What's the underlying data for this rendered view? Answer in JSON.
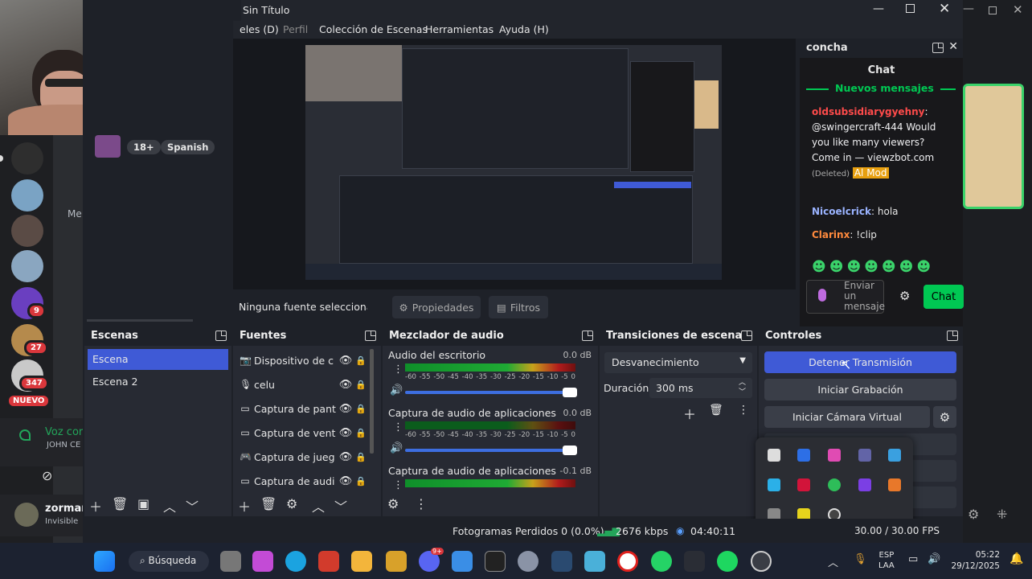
{
  "window": {
    "title": "Sin Título"
  },
  "menu": [
    "eles (D)",
    "Perfil",
    "Colección de Escenas",
    "Herramientas",
    "Ayuda (H)"
  ],
  "discord": {
    "tags": [
      "18+",
      "Spanish"
    ],
    "badges": [
      "9",
      "27",
      "347"
    ],
    "new_badge": "NUEVO",
    "voice": {
      "title": "Voz cor",
      "subtitle": "JOHN CE"
    },
    "user": {
      "name": "zorman",
      "status": "Invisible"
    },
    "partial_label": "Me"
  },
  "source_bar": {
    "status": "Ninguna fuente seleccionad",
    "properties": "Propiedades",
    "filters": "Filtros"
  },
  "scenes": {
    "title": "Escenas",
    "items": [
      "Escena",
      "Escena 2"
    ]
  },
  "sources": {
    "title": "Fuentes",
    "items": [
      "Dispositivo de c",
      "celu",
      "Captura de pant",
      "Captura de vent",
      "Captura de jueg",
      "Captura de audi"
    ]
  },
  "mixer": {
    "title": "Mezclador de audio",
    "channels": [
      {
        "name": "Audio del escritorio",
        "db": "0.0 dB"
      },
      {
        "name": "Captura de audio de aplicaciones (BE",
        "db": "0.0 dB"
      },
      {
        "name": "Captura de audio de aplicaciones (BE",
        "db": "-0.1 dB"
      }
    ],
    "scale": [
      "-60",
      "-55",
      "-50",
      "-45",
      "-40",
      "-35",
      "-30",
      "-25",
      "-20",
      "-15",
      "-10",
      "-5",
      "0"
    ]
  },
  "transitions": {
    "title": "Transiciones de escena",
    "selected": "Desvanecimiento",
    "duration_label": "Duración",
    "duration": "300 ms"
  },
  "controls": {
    "title": "Controles",
    "stop_stream": "Detener Transmisión",
    "start_recording": "Iniciar Grabación",
    "start_vcam": "Iniciar Cámara Virtual"
  },
  "chat": {
    "channel": "concha",
    "header": "Chat",
    "new_messages": "Nuevos mensajes",
    "messages": [
      {
        "user": "oldsubsidiarygyehny",
        "text": "@swingercraft-444 Would you like many viewers? Come in — viewzbot.com",
        "deleted": "(Deleted)",
        "tag": "Al Mod",
        "color": "#ff4b4b"
      },
      {
        "user": "Nicoelcrick",
        "text": "hola",
        "color": "#9ab3ff"
      },
      {
        "user": "Clarinx",
        "text": "!clip",
        "color": "#ff8a3d"
      }
    ],
    "input_placeholder": "Enviar un mensaje",
    "send": "Chat"
  },
  "status": {
    "dropped": "Fotogramas Perdidos 0 (0.0%)",
    "bitrate": "2676 kbps",
    "time": "04:40:11",
    "fps": "30.00 / 30.00 FPS"
  },
  "taskbar": {
    "search": "Búsqueda",
    "lang1": "ESP",
    "lang2": "LAA",
    "time": "05:22",
    "date": "29/12/2025",
    "notif": "9+"
  },
  "colors": {
    "accent": "#3f5ad6",
    "obs_bg": "#1e2128",
    "chat_green": "#00c853"
  }
}
